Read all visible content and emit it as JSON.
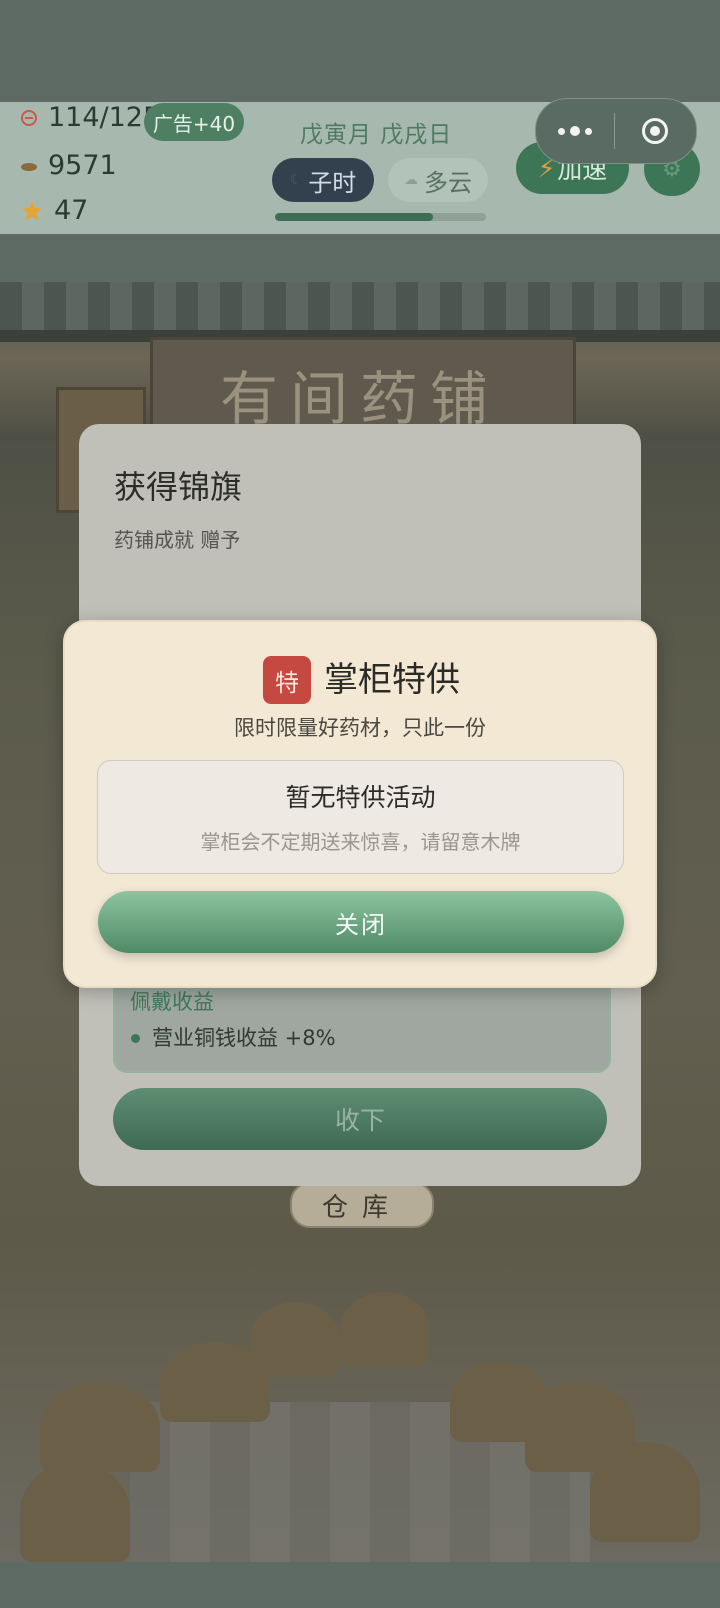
{
  "resources": {
    "stamina": "114/125",
    "ad_bonus": "广告+40",
    "coins": "9571",
    "stars": "47"
  },
  "calendar": {
    "date": "戊寅月 戊戌日",
    "hour": "子时",
    "weather": "多云",
    "day_progress_percent": 75
  },
  "actions": {
    "speed_label": "加速"
  },
  "scene": {
    "shop_sign": "有间药铺",
    "warehouse_plaque": "仓库"
  },
  "back_dialog": {
    "title": "获得锦旗",
    "subtitle": "药铺成就 赠予",
    "perk_heading": "佩戴收益",
    "perk_item": "营业铜钱收益 +8%",
    "confirm_label": "收下"
  },
  "special_offer": {
    "badge": "特",
    "title": "掌柜特供",
    "subtitle": "限时限量好药材，只此一份",
    "empty_title": "暂无特供活动",
    "empty_subtitle": "掌柜会不定期送来惊喜，请留意木牌",
    "close_label": "关闭"
  },
  "colors": {
    "accent_green": "#3d7656",
    "offer_badge_red": "#c64941",
    "dialog_cream": "#f3e8d4"
  }
}
